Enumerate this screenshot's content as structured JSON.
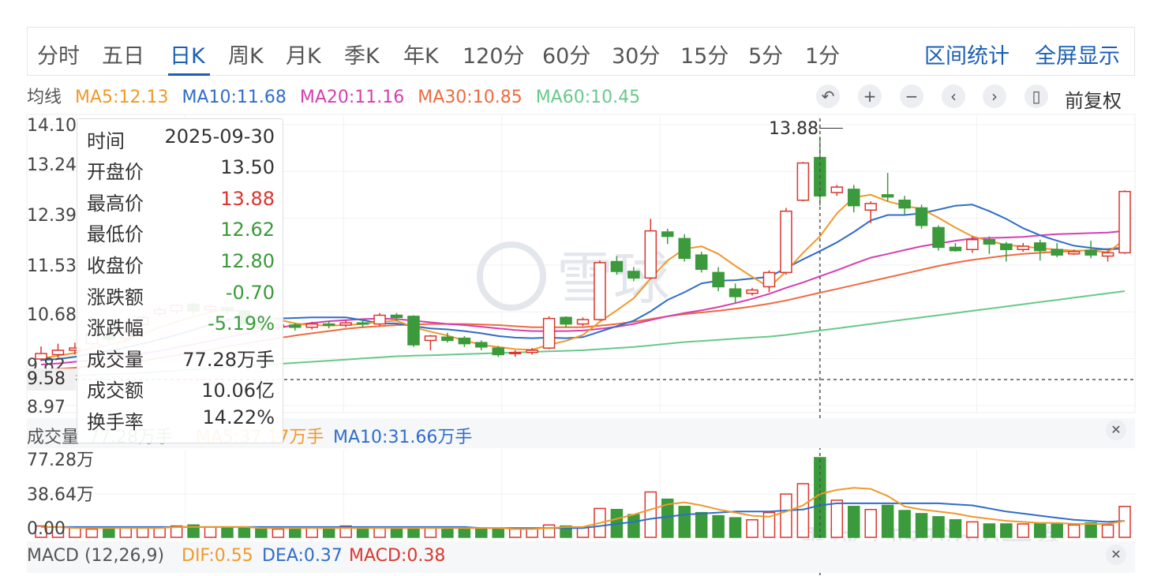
{
  "tabs": [
    "分时",
    "五日",
    "日K",
    "周K",
    "月K",
    "季K",
    "年K",
    "120分",
    "60分",
    "30分",
    "15分",
    "5分",
    "1分"
  ],
  "active_tab": "日K",
  "right_links": {
    "range_stats": "区间统计",
    "fullscreen": "全屏显示"
  },
  "ma_legend": {
    "label": "均线",
    "ma5": "MA5:12.13",
    "ma10": "MA10:11.68",
    "ma20": "MA20:11.16",
    "ma30": "MA30:10.85",
    "ma60": "MA60:10.45"
  },
  "controls": {
    "fuquan": "前复权"
  },
  "icons": [
    "undo-icon",
    "zoom-in-icon",
    "zoom-out-icon",
    "chevron-left-icon",
    "chevron-right-icon",
    "candlestick-icon",
    "close-icon"
  ],
  "tooltip": {
    "rows": [
      {
        "k": "时间",
        "v": "2025-09-30"
      },
      {
        "k": "开盘价",
        "v": "13.50"
      },
      {
        "k": "最高价",
        "v": "13.88"
      },
      {
        "k": "最低价",
        "v": "12.62"
      },
      {
        "k": "收盘价",
        "v": "12.80"
      },
      {
        "k": "涨跌额",
        "v": "-0.70"
      },
      {
        "k": "涨跌幅",
        "v": "-5.19%"
      },
      {
        "k": "成交量",
        "v": "77.28万手"
      },
      {
        "k": "成交额",
        "v": "10.06亿"
      },
      {
        "k": "换手率",
        "v": "14.22%"
      }
    ]
  },
  "price_axis": [
    "14.10",
    "13.24",
    "12.39",
    "11.53",
    "10.68",
    "9.82",
    "8.97"
  ],
  "cross_price": "9.58",
  "high_marker": "13.88",
  "volume": {
    "label": "成交量",
    "value": "77.28万手",
    "ma5": "MA5:37.17万手",
    "ma10": "MA10:31.66万手",
    "axis": [
      "77.28万",
      "38.64万",
      "0.00"
    ]
  },
  "macd": {
    "label": "MACD (12,26,9)",
    "dif": "DIF:0.55",
    "dea": "DEA:0.37",
    "macd": "MACD:0.38"
  },
  "watermark": {
    "center": "雪球",
    "bottom": "雪球 · 吃我ojo一拳"
  },
  "colors": {
    "up": "#d9362d",
    "down": "#3b9a3b",
    "ma5": "#f0992a",
    "ma10": "#2f6dc9",
    "ma20": "#d43fb0",
    "ma30": "#ee6b40",
    "ma60": "#67c98a",
    "accent": "#1a5fb4"
  },
  "chart_data": {
    "type": "candlestick",
    "title": "",
    "candles": [
      [
        9.82,
        9.92,
        10.05,
        9.78
      ],
      [
        9.9,
        9.98,
        10.1,
        9.85
      ],
      [
        9.98,
        10.02,
        10.12,
        9.9
      ],
      [
        10.1,
        10.28,
        10.32,
        10.05
      ],
      [
        10.28,
        10.18,
        10.35,
        10.1
      ],
      [
        10.2,
        10.3,
        10.38,
        10.12
      ],
      [
        10.45,
        10.58,
        10.62,
        10.4
      ],
      [
        10.65,
        10.72,
        10.78,
        10.6
      ],
      [
        10.7,
        10.8,
        10.82,
        10.64
      ],
      [
        10.82,
        10.7,
        10.86,
        10.62
      ],
      [
        10.72,
        10.78,
        10.82,
        10.68
      ],
      [
        10.76,
        10.7,
        10.8,
        10.64
      ],
      [
        10.7,
        10.46,
        10.74,
        10.4
      ],
      [
        10.46,
        10.38,
        10.5,
        10.32
      ],
      [
        10.4,
        10.44,
        10.48,
        10.34
      ],
      [
        10.44,
        10.4,
        10.48,
        10.34
      ],
      [
        10.4,
        10.46,
        10.5,
        10.36
      ],
      [
        10.46,
        10.44,
        10.52,
        10.38
      ],
      [
        10.44,
        10.48,
        10.52,
        10.4
      ],
      [
        10.48,
        10.46,
        10.54,
        10.4
      ],
      [
        10.46,
        10.62,
        10.66,
        10.42
      ],
      [
        10.62,
        10.58,
        10.66,
        10.52
      ],
      [
        10.6,
        10.08,
        10.62,
        10.04
      ],
      [
        10.16,
        10.24,
        10.26,
        9.98
      ],
      [
        10.22,
        10.16,
        10.3,
        10.12
      ],
      [
        10.2,
        10.1,
        10.24,
        10.04
      ],
      [
        10.12,
        10.04,
        10.16,
        9.98
      ],
      [
        10.02,
        9.9,
        10.06,
        9.86
      ],
      [
        9.92,
        9.94,
        9.98,
        9.86
      ],
      [
        9.94,
        9.98,
        10.02,
        9.9
      ],
      [
        10.02,
        10.56,
        10.6,
        10.0
      ],
      [
        10.58,
        10.46,
        10.6,
        10.4
      ],
      [
        10.46,
        10.54,
        10.58,
        10.42
      ],
      [
        10.54,
        11.58,
        11.62,
        10.52
      ],
      [
        11.6,
        11.42,
        11.7,
        11.36
      ],
      [
        11.42,
        11.3,
        11.5,
        11.24
      ],
      [
        11.3,
        12.16,
        12.38,
        11.28
      ],
      [
        12.14,
        12.06,
        12.2,
        11.92
      ],
      [
        12.02,
        11.66,
        12.1,
        11.6
      ],
      [
        11.72,
        11.46,
        11.78,
        11.4
      ],
      [
        11.4,
        11.14,
        11.5,
        11.06
      ],
      [
        11.1,
        10.96,
        11.2,
        10.84
      ],
      [
        11.02,
        11.08,
        11.12,
        10.98
      ],
      [
        11.14,
        11.4,
        11.44,
        11.04
      ],
      [
        11.4,
        12.52,
        12.58,
        11.36
      ],
      [
        12.72,
        13.4,
        13.42,
        12.7
      ],
      [
        13.5,
        12.8,
        13.88,
        12.62
      ],
      [
        12.86,
        12.96,
        13.0,
        12.8
      ],
      [
        12.92,
        12.62,
        13.0,
        12.5
      ],
      [
        12.54,
        12.66,
        12.7,
        12.3
      ],
      [
        12.82,
        12.78,
        13.22,
        12.7
      ],
      [
        12.72,
        12.58,
        12.8,
        12.46
      ],
      [
        12.58,
        12.26,
        12.64,
        12.2
      ],
      [
        12.22,
        11.86,
        12.26,
        11.8
      ],
      [
        11.86,
        11.8,
        11.94,
        11.78
      ],
      [
        11.82,
        12.0,
        12.06,
        11.76
      ],
      [
        12.0,
        11.92,
        12.06,
        11.74
      ],
      [
        11.92,
        11.82,
        11.96,
        11.6
      ],
      [
        11.82,
        11.88,
        11.94,
        11.78
      ],
      [
        11.94,
        11.8,
        12.0,
        11.62
      ],
      [
        11.82,
        11.72,
        11.94,
        11.68
      ],
      [
        11.74,
        11.78,
        11.82,
        11.72
      ],
      [
        11.8,
        11.72,
        11.98,
        11.66
      ],
      [
        11.7,
        11.76,
        11.8,
        11.6
      ],
      [
        11.76,
        12.88,
        12.9,
        11.74
      ]
    ],
    "ma5": [
      9.83,
      9.88,
      9.93,
      10.02,
      10.08,
      10.15,
      10.28,
      10.4,
      10.5,
      10.59,
      10.68,
      10.73,
      10.68,
      10.6,
      10.54,
      10.47,
      10.44,
      10.43,
      10.44,
      10.46,
      10.5,
      10.52,
      10.4,
      10.32,
      10.25,
      10.16,
      10.08,
      10.04,
      10.0,
      9.99,
      10.08,
      10.15,
      10.26,
      10.5,
      10.71,
      10.93,
      11.29,
      11.62,
      11.83,
      11.88,
      11.74,
      11.52,
      11.32,
      11.13,
      11.42,
      11.76,
      12.06,
      12.48,
      12.77,
      12.82,
      12.7,
      12.62,
      12.56,
      12.4,
      12.22,
      12.06,
      11.98,
      11.9,
      11.88,
      11.84,
      11.82,
      11.8,
      11.8,
      11.77,
      12.0
    ],
    "ma10": [
      9.8,
      9.82,
      9.86,
      9.92,
      9.97,
      10.03,
      10.1,
      10.18,
      10.26,
      10.35,
      10.45,
      10.54,
      10.58,
      10.58,
      10.56,
      10.57,
      10.58,
      10.58,
      10.58,
      10.53,
      10.47,
      10.47,
      10.42,
      10.38,
      10.36,
      10.33,
      10.29,
      10.24,
      10.21,
      10.2,
      10.21,
      10.2,
      10.22,
      10.32,
      10.42,
      10.52,
      10.69,
      10.9,
      11.04,
      11.2,
      11.25,
      11.26,
      11.29,
      11.32,
      11.48,
      11.64,
      11.79,
      11.95,
      12.14,
      12.35,
      12.45,
      12.45,
      12.48,
      12.55,
      12.62,
      12.64,
      12.52,
      12.38,
      12.21,
      12.08,
      11.98,
      11.89,
      11.85,
      11.82,
      11.84
    ],
    "ma20": [
      9.72,
      9.74,
      9.77,
      9.8,
      9.83,
      9.87,
      9.92,
      9.97,
      10.03,
      10.09,
      10.15,
      10.22,
      10.28,
      10.34,
      10.39,
      10.44,
      10.48,
      10.51,
      10.53,
      10.55,
      10.56,
      10.55,
      10.52,
      10.49,
      10.46,
      10.44,
      10.41,
      10.38,
      10.35,
      10.33,
      10.33,
      10.33,
      10.34,
      10.37,
      10.41,
      10.46,
      10.53,
      10.6,
      10.66,
      10.71,
      10.77,
      10.84,
      10.92,
      11.01,
      11.12,
      11.22,
      11.33,
      11.44,
      11.56,
      11.67,
      11.74,
      11.81,
      11.88,
      11.93,
      11.98,
      12.02,
      12.03,
      12.04,
      12.05,
      12.08,
      12.1,
      12.11,
      12.12,
      12.13,
      12.16
    ],
    "ma30": [
      9.62,
      9.64,
      9.66,
      9.69,
      9.72,
      9.75,
      9.79,
      9.84,
      9.89,
      9.94,
      9.99,
      10.05,
      10.1,
      10.15,
      10.2,
      10.25,
      10.29,
      10.33,
      10.37,
      10.4,
      10.42,
      10.44,
      10.45,
      10.46,
      10.46,
      10.46,
      10.45,
      10.44,
      10.42,
      10.4,
      10.4,
      10.4,
      10.4,
      10.43,
      10.46,
      10.5,
      10.55,
      10.6,
      10.64,
      10.67,
      10.7,
      10.74,
      10.78,
      10.83,
      10.89,
      10.96,
      11.03,
      11.1,
      11.17,
      11.24,
      11.31,
      11.38,
      11.45,
      11.52,
      11.58,
      11.63,
      11.67,
      11.71,
      11.74,
      11.76,
      11.78,
      11.79,
      11.81,
      11.83,
      11.86
    ],
    "ma60": [
      9.5,
      9.51,
      9.52,
      9.53,
      9.54,
      9.55,
      9.57,
      9.59,
      9.61,
      9.63,
      9.65,
      9.67,
      9.69,
      9.71,
      9.73,
      9.75,
      9.77,
      9.79,
      9.81,
      9.83,
      9.85,
      9.87,
      9.88,
      9.89,
      9.9,
      9.91,
      9.92,
      9.93,
      9.94,
      9.95,
      9.96,
      9.97,
      9.98,
      10.0,
      10.02,
      10.04,
      10.07,
      10.1,
      10.13,
      10.15,
      10.17,
      10.19,
      10.21,
      10.23,
      10.26,
      10.3,
      10.34,
      10.38,
      10.42,
      10.46,
      10.5,
      10.54,
      10.58,
      10.62,
      10.66,
      10.7,
      10.74,
      10.78,
      10.82,
      10.86,
      10.9,
      10.94,
      10.98,
      11.02,
      11.06
    ],
    "volume": [
      11,
      10,
      9,
      8,
      8,
      9,
      10,
      9,
      11,
      12,
      10,
      9,
      9,
      8,
      8,
      9,
      9,
      10,
      11,
      10,
      9,
      9,
      10,
      9,
      8,
      8,
      9,
      8,
      8,
      9,
      12,
      11,
      10,
      28,
      27,
      22,
      44,
      37,
      30,
      24,
      21,
      19,
      17,
      24,
      42,
      52,
      77.28,
      36,
      30,
      27,
      31,
      26,
      23,
      20,
      17,
      15,
      13,
      13,
      13,
      14,
      13,
      12,
      14,
      12,
      30
    ],
    "vol_ma5": [
      10,
      10,
      9,
      9,
      9,
      9,
      9,
      9,
      10,
      10,
      10,
      10,
      10,
      9,
      9,
      9,
      9,
      9,
      9,
      9,
      9,
      9,
      9,
      9,
      9,
      9,
      9,
      9,
      8,
      8,
      9,
      10,
      10,
      14,
      18,
      22,
      27,
      32,
      34,
      31,
      27,
      24,
      21,
      20,
      25,
      31,
      42,
      46,
      48,
      47,
      40,
      30,
      27,
      25,
      23,
      20,
      18,
      16,
      15,
      14,
      14,
      13,
      13,
      13,
      16
    ],
    "vol_ma10": [
      10,
      10,
      10,
      10,
      10,
      10,
      10,
      10,
      10,
      10,
      10,
      10,
      10,
      10,
      10,
      10,
      10,
      10,
      10,
      10,
      10,
      10,
      10,
      10,
      10,
      10,
      9,
      9,
      9,
      9,
      9,
      9,
      9,
      11,
      13,
      15,
      18,
      20,
      22,
      23,
      24,
      25,
      25,
      25,
      26,
      27,
      31,
      33,
      33,
      33,
      33,
      33,
      33,
      33,
      32,
      31,
      28,
      25,
      23,
      21,
      19,
      17,
      16,
      15,
      16
    ],
    "ylim": [
      8.97,
      14.1
    ]
  }
}
